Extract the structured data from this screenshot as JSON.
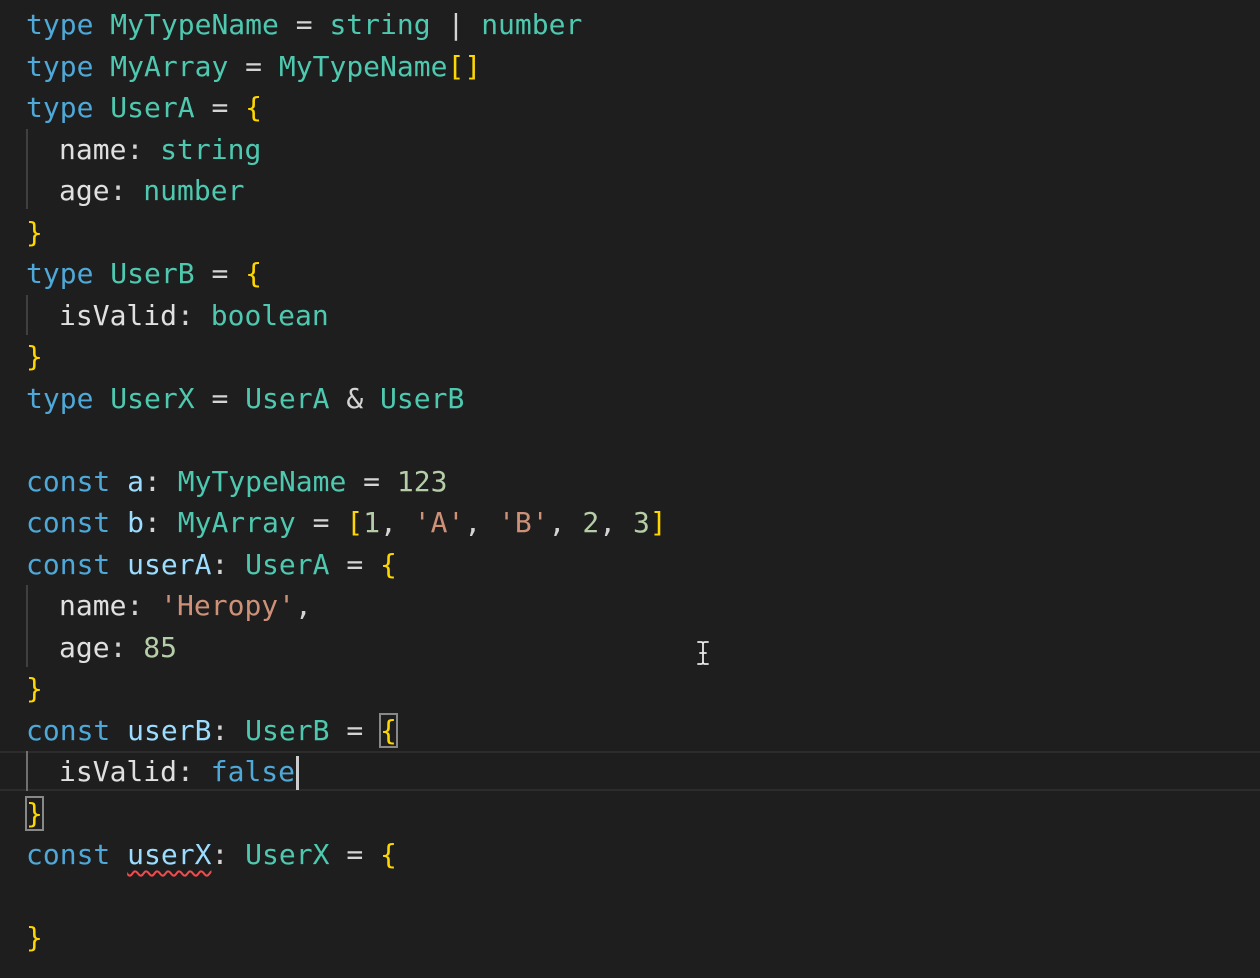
{
  "editor": {
    "language": "typescript",
    "colors": {
      "background": "#1e1e1e",
      "keyword": "#4ea8d8",
      "type": "#4ec9b0",
      "variable": "#9cdcfe",
      "string": "#ce9178",
      "number": "#b5cea8",
      "brace": "#ffd700",
      "error_squiggle": "#f14c4c"
    },
    "code": {
      "l1": {
        "kw": "type",
        "name": "MyTypeName",
        "eq": "=",
        "t1": "string",
        "pipe": "|",
        "t2": "number"
      },
      "l2": {
        "kw": "type",
        "name": "MyArray",
        "eq": "=",
        "ref": "MyTypeName",
        "brackets": "[]"
      },
      "l3": {
        "kw": "type",
        "name": "UserA",
        "eq": "=",
        "open": "{"
      },
      "l4": {
        "key": "name",
        "colon": ":",
        "t": "string"
      },
      "l5": {
        "key": "age",
        "colon": ":",
        "t": "number"
      },
      "l6": {
        "close": "}"
      },
      "l7": {
        "kw": "type",
        "name": "UserB",
        "eq": "=",
        "open": "{"
      },
      "l8": {
        "key": "isValid",
        "colon": ":",
        "t": "boolean"
      },
      "l9": {
        "close": "}"
      },
      "l10": {
        "kw": "type",
        "name": "UserX",
        "eq": "=",
        "a": "UserA",
        "amp": "&",
        "b": "UserB"
      },
      "l12": {
        "kw": "const",
        "var": "a",
        "colon": ":",
        "t": "MyTypeName",
        "eq": "=",
        "val": "123"
      },
      "l13": {
        "kw": "const",
        "var": "b",
        "colon": ":",
        "t": "MyArray",
        "eq": "=",
        "lb": "[",
        "v1": "1",
        "c1": ",",
        "v2": "'A'",
        "c2": ",",
        "v3": "'B'",
        "c3": ",",
        "v4": "2",
        "c4": ",",
        "v5": "3",
        "rb": "]"
      },
      "l14": {
        "kw": "const",
        "var": "userA",
        "colon": ":",
        "t": "UserA",
        "eq": "=",
        "open": "{"
      },
      "l15": {
        "key": "name",
        "colon": ":",
        "val": "'Heropy'",
        "comma": ","
      },
      "l16": {
        "key": "age",
        "colon": ":",
        "val": "85"
      },
      "l17": {
        "close": "}"
      },
      "l18": {
        "kw": "const",
        "var": "userB",
        "colon": ":",
        "t": "UserB",
        "eq": "=",
        "open": "{"
      },
      "l19": {
        "key": "isValid",
        "colon": ":",
        "val": "false"
      },
      "l20": {
        "close": "}"
      },
      "l21": {
        "kw": "const",
        "var": "userX",
        "colon": ":",
        "t": "UserX",
        "eq": "=",
        "open": "{"
      },
      "l23": {
        "close": "}"
      }
    },
    "icons": {
      "text_cursor": "i-beam-icon"
    }
  }
}
